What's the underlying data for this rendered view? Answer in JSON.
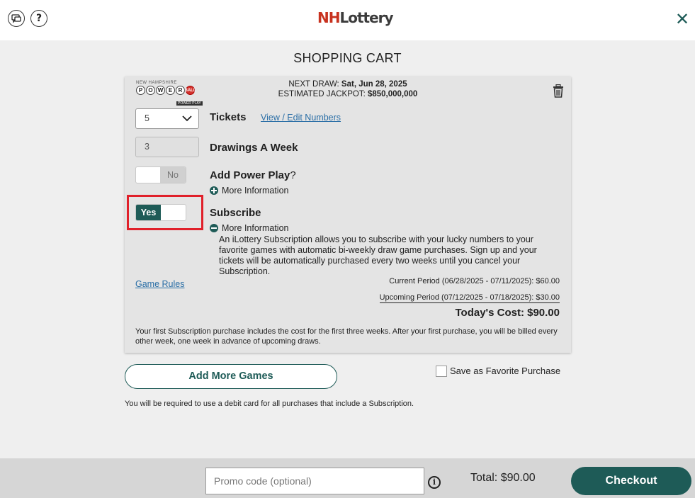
{
  "header": {
    "logo_text_nh": "NH",
    "logo_text_lottery": "Lottery",
    "help_glyph": "?",
    "close_glyph": "✕",
    "icons": {
      "chat": "chat-bubble-icon",
      "help": "help-icon",
      "close": "close-icon"
    }
  },
  "page_title": "SHOPPING CART",
  "cart_item": {
    "game_logo": {
      "state": "NEW HAMPSHIRE",
      "balls": [
        "P",
        "O",
        "W",
        "E",
        "R",
        "BALL"
      ],
      "power_play": "POWER PLAY"
    },
    "next_draw_label": "NEXT DRAW:",
    "next_draw_value": "Sat, Jun 28, 2025",
    "jackpot_label": "ESTIMATED JACKPOT:",
    "jackpot_value": "$850,000,000",
    "tickets": {
      "value": "5",
      "label": "Tickets",
      "link": "View / Edit Numbers"
    },
    "drawings": {
      "value": "3",
      "label": "Drawings A Week"
    },
    "power_play": {
      "label": "Add Power Play",
      "suffix": "?",
      "toggle_state": "No",
      "more_info": "More Information"
    },
    "subscribe": {
      "label": "Subscribe",
      "toggle_state": "Yes",
      "more_info": "More Information",
      "description": "An iLottery Subscription allows you to subscribe with your lucky numbers to your favorite games with automatic bi-weekly draw game purchases. Sign up and your tickets will be automatically purchased every two weeks until you cancel your Subscription."
    },
    "game_rules": "Game Rules",
    "current_period": "Current Period (06/28/2025 - 07/11/2025): $60.00",
    "upcoming_period": "Upcoming Period (07/12/2025 - 07/18/2025): $30.00",
    "todays_cost": "Today's Cost: $90.00",
    "note": "Your first Subscription purchase includes the cost for the first three weeks. After your first purchase, you will be billed every other week, one week in advance of upcoming draws."
  },
  "add_more_games": "Add More Games",
  "save_favorite": "Save as Favorite Purchase",
  "debit_note": "You will be required to use a debit card for all purchases that include a Subscription.",
  "footer": {
    "promo_placeholder": "Promo code (optional)",
    "info_glyph": "i",
    "total": "Total: $90.00",
    "checkout": "Checkout"
  },
  "colors": {
    "accent": "#1e5b57",
    "highlight": "#e0202a",
    "link": "#2a6ea6"
  }
}
